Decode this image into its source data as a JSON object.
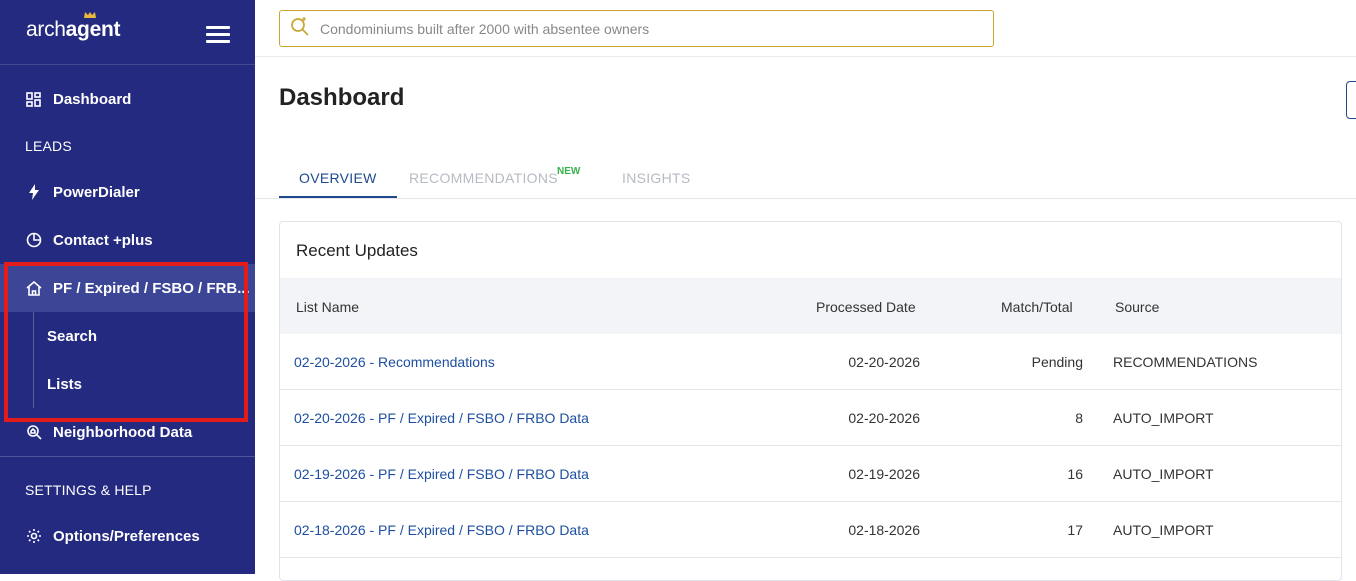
{
  "brand": {
    "logo_prefix": "arch",
    "logo_suffix": "agent"
  },
  "sidebar": {
    "dashboard_label": "Dashboard",
    "leads_heading": "LEADS",
    "powerdialer_label": "PowerDialer",
    "contact_label": "Contact +plus",
    "pf_label": "PF / Expired / FSBO / FRB...",
    "search_label": "Search",
    "lists_label": "Lists",
    "neighborhood_label": "Neighborhood Data",
    "settings_heading": "SETTINGS & HELP",
    "options_label": "Options/Preferences"
  },
  "search": {
    "placeholder": "Condominiums built after 2000 with absentee owners"
  },
  "main": {
    "title": "Dashboard",
    "tabs": [
      {
        "label": "OVERVIEW"
      },
      {
        "label": "RECOMMENDATIONS",
        "badge": "NEW"
      },
      {
        "label": "INSIGHTS"
      }
    ]
  },
  "recent_updates": {
    "title": "Recent Updates",
    "columns": [
      "List Name",
      "Processed Date",
      "Match/Total",
      "Source"
    ],
    "rows": [
      {
        "name": "02-20-2026 - Recommendations",
        "date": "02-20-2026",
        "match": "Pending",
        "source": "RECOMMENDATIONS"
      },
      {
        "name": "02-20-2026 - PF / Expired / FSBO / FRBO Data",
        "date": "02-20-2026",
        "match": "8",
        "source": "AUTO_IMPORT"
      },
      {
        "name": "02-19-2026 - PF / Expired / FSBO / FRBO Data",
        "date": "02-19-2026",
        "match": "16",
        "source": "AUTO_IMPORT"
      },
      {
        "name": "02-18-2026 - PF / Expired / FSBO / FRBO Data",
        "date": "02-18-2026",
        "match": "17",
        "source": "AUTO_IMPORT"
      }
    ]
  },
  "colors": {
    "sidebar": "#232a7f",
    "accent": "#1e4a8c",
    "highlight": "#e21b1b",
    "badge": "#37b24d"
  }
}
